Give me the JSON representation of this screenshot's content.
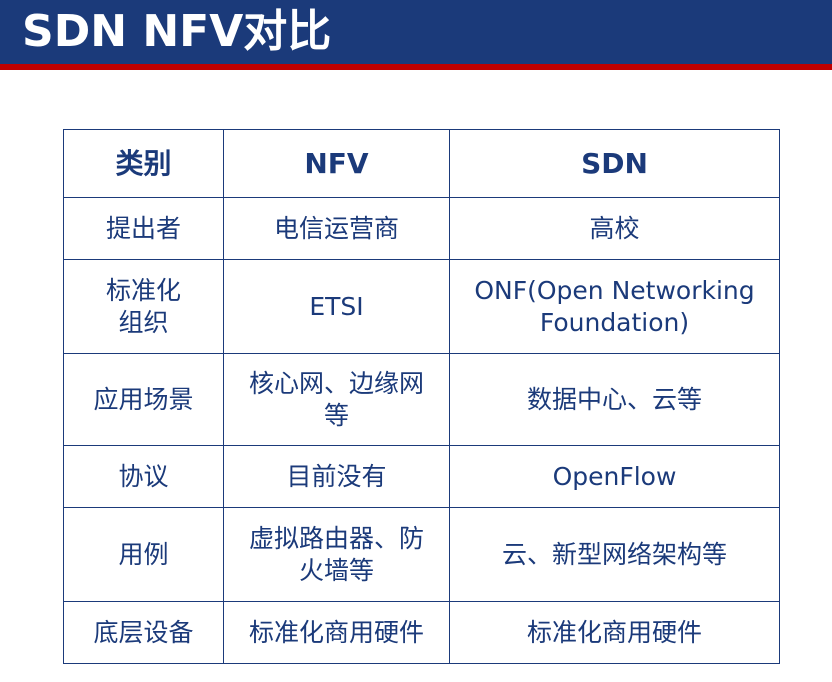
{
  "slide": {
    "title": "SDN NFV对比"
  },
  "colors": {
    "title_bar": "#1b3a7a",
    "title_underline": "#c00000",
    "table_text": "#1b3a7a",
    "table_border": "#1b3a7a"
  },
  "table": {
    "headers": [
      "类别",
      "NFV",
      "SDN"
    ],
    "rows": [
      {
        "category": "提出者",
        "nfv": "电信运营商",
        "sdn": "高校"
      },
      {
        "category": "标准化组织",
        "nfv": "ETSI",
        "sdn": "ONF(Open Networking Foundation)"
      },
      {
        "category": "应用场景",
        "nfv": "核心网、边缘网等",
        "sdn": "数据中心、云等"
      },
      {
        "category": "协议",
        "nfv": "目前没有",
        "sdn": "OpenFlow"
      },
      {
        "category": "用例",
        "nfv": "虚拟路由器、防火墙等",
        "sdn": "云、新型网络架构等"
      },
      {
        "category": "底层设备",
        "nfv": "标准化商用硬件",
        "sdn": "标准化商用硬件"
      }
    ]
  }
}
